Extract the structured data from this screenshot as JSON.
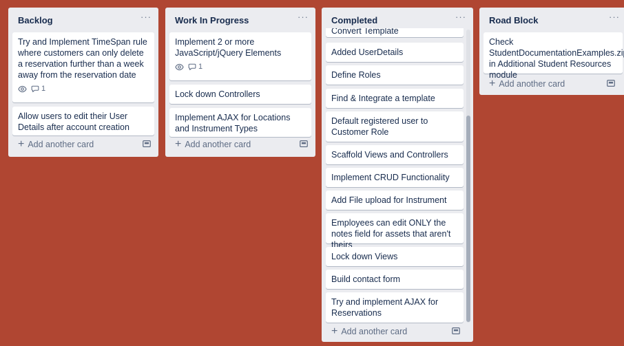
{
  "colors": {
    "board_background": "#b04632",
    "list_background": "#ebecf0",
    "card_background": "#ffffff",
    "text": "#172b4d",
    "muted_text": "#5e6c84"
  },
  "icons": {
    "watch": "eye-icon",
    "comment": "comment-icon",
    "add": "plus-icon",
    "template": "card-template-icon",
    "menu": "ellipsis-icon"
  },
  "common": {
    "menu_glyph": "···",
    "add_plus": "+",
    "add_card_label": "Add another card"
  },
  "lists": [
    {
      "title": "Backlog",
      "cards": [
        {
          "text": "Try and Implement TimeSpan rule where customers can only delete a reservation further than a week away from the reservation date",
          "comments": "1"
        },
        {
          "text": "Allow users to edit their User Details after account creation"
        }
      ]
    },
    {
      "title": "Work In Progress",
      "cards": [
        {
          "text": "Implement 2 or more JavaScript/jQuery Elements",
          "comments": "1"
        },
        {
          "text": "Lock down Controllers"
        },
        {
          "text": "Implement AJAX for Locations and Instrument Types"
        }
      ]
    },
    {
      "title": "Completed",
      "cards": [
        {
          "text": "Convert Template"
        },
        {
          "text": "Added UserDetails"
        },
        {
          "text": "Define Roles"
        },
        {
          "text": "Find & Integrate a template"
        },
        {
          "text": "Default registered user to Customer Role"
        },
        {
          "text": "Scaffold Views and Controllers"
        },
        {
          "text": "Implement CRUD Functionality"
        },
        {
          "text": "Add File upload for Instrument"
        },
        {
          "text": "Employees can edit ONLY the notes field for assets that aren't theirs"
        },
        {
          "text": "Lock down Views"
        },
        {
          "text": "Build contact form"
        },
        {
          "text": "Try and implement AJAX for Reservations"
        }
      ]
    },
    {
      "title": "Road Block",
      "cards": [
        {
          "text": "Check StudentDocumentationExamples.zip in Additional Student Resources module"
        }
      ]
    }
  ]
}
